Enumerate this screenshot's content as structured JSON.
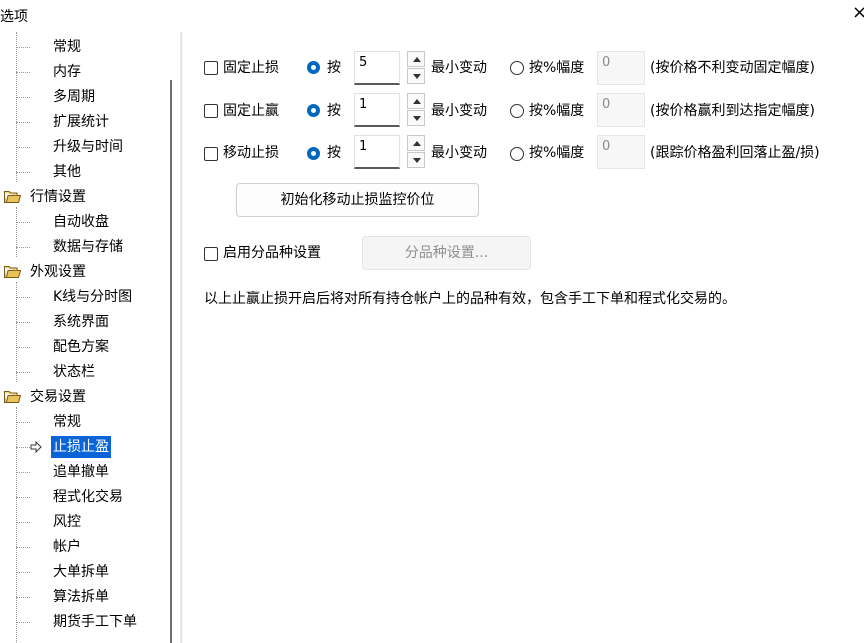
{
  "window": {
    "title": "选项",
    "close_glyph": "×"
  },
  "tree": {
    "items": [
      {
        "label": "常规",
        "level": 1
      },
      {
        "label": "内存",
        "level": 1
      },
      {
        "label": "多周期",
        "level": 1
      },
      {
        "label": "扩展统计",
        "level": 1
      },
      {
        "label": "升级与时间",
        "level": 1
      },
      {
        "label": "其他",
        "level": 1
      },
      {
        "label": "行情设置",
        "level": 0
      },
      {
        "label": "自动收盘",
        "level": 1
      },
      {
        "label": "数据与存储",
        "level": 1
      },
      {
        "label": "外观设置",
        "level": 0
      },
      {
        "label": "K线与分时图",
        "level": 1
      },
      {
        "label": "系统界面",
        "level": 1
      },
      {
        "label": "配色方案",
        "level": 1
      },
      {
        "label": "状态栏",
        "level": 1
      },
      {
        "label": "交易设置",
        "level": 0
      },
      {
        "label": "常规",
        "level": 1
      },
      {
        "label": "止损止盈",
        "level": 1,
        "selected": true
      },
      {
        "label": "追单撤单",
        "level": 1
      },
      {
        "label": "程式化交易",
        "level": 1
      },
      {
        "label": "风控",
        "level": 1
      },
      {
        "label": "帐户",
        "level": 1
      },
      {
        "label": "大单拆单",
        "level": 1
      },
      {
        "label": "算法拆单",
        "level": 1
      },
      {
        "label": "期货手工下单",
        "level": 1
      }
    ]
  },
  "rows": [
    {
      "check_label": "固定止损",
      "radio_by": "按",
      "value": "5",
      "unit": "最小变动",
      "radio_pct": "按%幅度",
      "pct_value": "0",
      "desc": "(按价格不利变动固定幅度)"
    },
    {
      "check_label": "固定止赢",
      "radio_by": "按",
      "value": "1",
      "unit": "最小变动",
      "radio_pct": "按%幅度",
      "pct_value": "0",
      "desc": "(按价格赢利到达指定幅度)"
    },
    {
      "check_label": "移动止损",
      "radio_by": "按",
      "value": "1",
      "unit": "最小变动",
      "radio_pct": "按%幅度",
      "pct_value": "0",
      "desc": "(跟踪价格盈利回落止盈/损)"
    }
  ],
  "init_button": "初始化移动止损监控价位",
  "variety": {
    "check_label": "启用分品种设置",
    "button": "分品种设置..."
  },
  "note": "以上止赢止损开启后将对所有持仓帐户上的品种有效，包含手工下单和程式化交易的。",
  "colors": {
    "accent": "#0067c0",
    "selection": "#0a64d8"
  },
  "icons": {
    "folder": "folder-icon",
    "pointer": "arrow-pointer-icon",
    "close": "close-icon"
  }
}
